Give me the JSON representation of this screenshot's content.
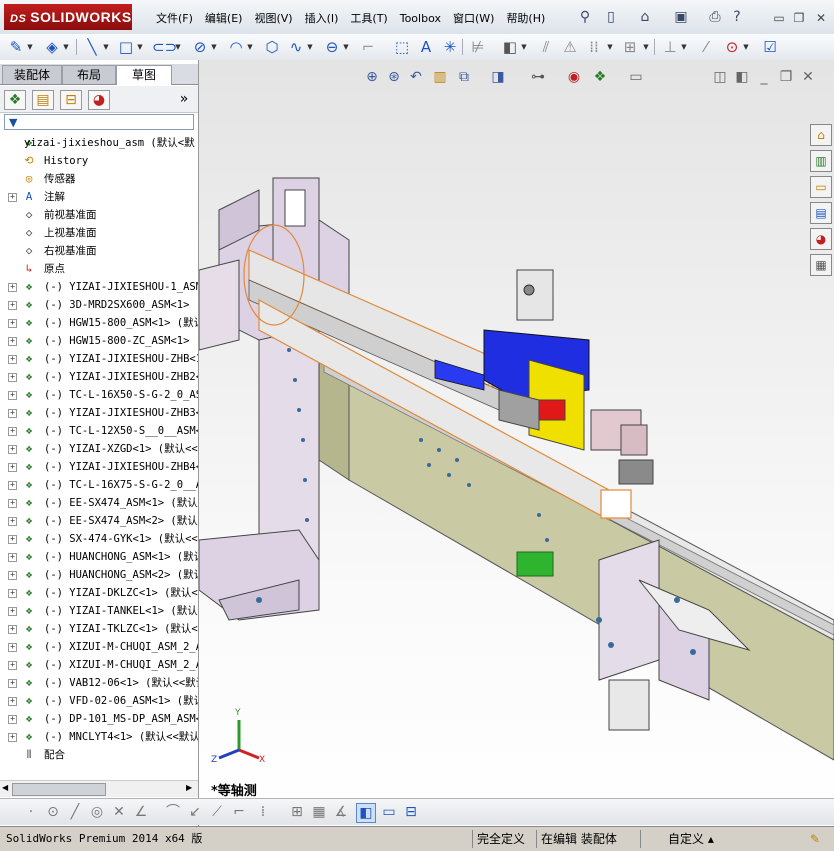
{
  "app": {
    "logo_text": "SOLIDWORKS",
    "logo_prefix": "DS"
  },
  "menu": [
    "文件(F)",
    "编辑(E)",
    "视图(V)",
    "插入(I)",
    "工具(T)",
    "Toolbox",
    "窗口(W)",
    "帮助(H)"
  ],
  "panel_tabs": [
    "装配体",
    "布局",
    "草图"
  ],
  "filter_icon": "funnel-icon",
  "tree": [
    {
      "label": "yizai-jixieshou_asm  (默认<默",
      "expander": "",
      "icon": "assembly-icon"
    },
    {
      "label": "History",
      "expander": "",
      "icon": "history-icon"
    },
    {
      "label": "传感器",
      "expander": "",
      "icon": "sensor-icon"
    },
    {
      "label": "注解",
      "expander": "+",
      "icon": "annotation-icon"
    },
    {
      "label": "前视基准面",
      "expander": "",
      "icon": "plane-icon"
    },
    {
      "label": "上视基准面",
      "expander": "",
      "icon": "plane-icon"
    },
    {
      "label": "右视基准面",
      "expander": "",
      "icon": "plane-icon"
    },
    {
      "label": "原点",
      "expander": "",
      "icon": "origin-icon"
    },
    {
      "label": "(-) YIZAI-JIXIESHOU-1_ASM<",
      "expander": "+",
      "icon": "subassembly-icon"
    },
    {
      "label": "(-) 3D-MRD2SX600_ASM<1> (",
      "expander": "+",
      "icon": "subassembly-icon"
    },
    {
      "label": "(-) HGW15-800_ASM<1> (默认",
      "expander": "+",
      "icon": "subassembly-icon"
    },
    {
      "label": "(-) HGW15-800-ZC_ASM<1> (",
      "expander": "+",
      "icon": "subassembly-icon"
    },
    {
      "label": "(-) YIZAI-JIXIESHOU-ZHB<1",
      "expander": "+",
      "icon": "subassembly-icon"
    },
    {
      "label": "(-) YIZAI-JIXIESHOU-ZHB2<",
      "expander": "+",
      "icon": "subassembly-icon"
    },
    {
      "label": "(-) TC-L-16X50-S-G-2_0_AS",
      "expander": "+",
      "icon": "subassembly-icon"
    },
    {
      "label": "(-) YIZAI-JIXIESHOU-ZHB3<",
      "expander": "+",
      "icon": "subassembly-icon"
    },
    {
      "label": "(-) TC-L-12X50-S__0__ASM<",
      "expander": "+",
      "icon": "subassembly-icon"
    },
    {
      "label": "(-) YIZAI-XZGD<1> (默认<<",
      "expander": "+",
      "icon": "subassembly-icon"
    },
    {
      "label": "(-) YIZAI-JIXIESHOU-ZHB4<",
      "expander": "+",
      "icon": "subassembly-icon"
    },
    {
      "label": "(-) TC-L-16X75-S-G-2_0__AS",
      "expander": "+",
      "icon": "subassembly-icon"
    },
    {
      "label": "(-) EE-SX474_ASM<1> (默认<",
      "expander": "+",
      "icon": "subassembly-icon"
    },
    {
      "label": "(-) EE-SX474_ASM<2> (默认<",
      "expander": "+",
      "icon": "subassembly-icon"
    },
    {
      "label": "(-) SX-474-GYK<1> (默认<<默",
      "expander": "+",
      "icon": "subassembly-icon"
    },
    {
      "label": "(-) HUANCHONG_ASM<1> (默认<",
      "expander": "+",
      "icon": "subassembly-icon"
    },
    {
      "label": "(-) HUANCHONG_ASM<2> (默认<",
      "expander": "+",
      "icon": "subassembly-icon"
    },
    {
      "label": "(-) YIZAI-DKLZC<1> (默认<<",
      "expander": "+",
      "icon": "subassembly-icon"
    },
    {
      "label": "(-) YIZAI-TANKEL<1> (默认<<",
      "expander": "+",
      "icon": "subassembly-icon"
    },
    {
      "label": "(-) YIZAI-TKLZC<1> (默认<<",
      "expander": "+",
      "icon": "subassembly-icon"
    },
    {
      "label": "(-) XIZUI-M-CHUQI_ASM_2_AS",
      "expander": "+",
      "icon": "subassembly-icon"
    },
    {
      "label": "(-) XIZUI-M-CHUQI_ASM_2_AS",
      "expander": "+",
      "icon": "subassembly-icon"
    },
    {
      "label": "(-) VAB12-06<1> (默认<<默认",
      "expander": "+",
      "icon": "subassembly-icon"
    },
    {
      "label": "(-) VFD-02-06_ASM<1> (默认<",
      "expander": "+",
      "icon": "subassembly-icon"
    },
    {
      "label": "(-) DP-101_MS-DP_ASM_ASM<",
      "expander": "+",
      "icon": "subassembly-icon"
    },
    {
      "label": "(-) MNCLYT4<1> (默认<<默认",
      "expander": "+",
      "icon": "subassembly-icon"
    },
    {
      "label": "配合",
      "expander": "",
      "icon": "mates-icon"
    }
  ],
  "viewport": {
    "view_label": "*等轴测"
  },
  "status": {
    "product": "SolidWorks Premium 2014 x64 版",
    "definition": "完全定义",
    "mode": "在编辑 装配体",
    "units": "自定义"
  },
  "colors": {
    "brand_red": "#b51717",
    "frame_purple": "#d8cfe0",
    "rail_olive": "#c9c9a3",
    "block_blue": "#1f2ee0",
    "block_yellow": "#f0e000",
    "highlight_orange": "#e08a3a"
  }
}
